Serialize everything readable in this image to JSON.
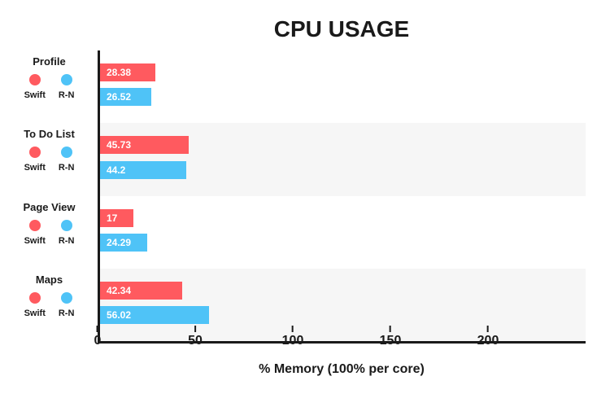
{
  "chart_data": {
    "type": "bar",
    "orientation": "horizontal",
    "title": "CPU USAGE",
    "xlabel": "% Memory (100% per core)",
    "ylabel": "",
    "xlim": [
      0,
      250
    ],
    "x_ticks": [
      0,
      50,
      100,
      150,
      200
    ],
    "categories": [
      "Profile",
      "To Do List",
      "Page View",
      "Maps"
    ],
    "series": [
      {
        "name": "Swift",
        "color": "#ff5a5f",
        "values": [
          28.38,
          45.73,
          17,
          42.34
        ]
      },
      {
        "name": "R-N",
        "color": "#4fc3f7",
        "values": [
          26.52,
          44.2,
          24.29,
          56.02
        ]
      }
    ],
    "legend": {
      "items": [
        {
          "name": "Swift",
          "color": "#ff5a5f"
        },
        {
          "name": "R-N",
          "color": "#4fc3f7"
        }
      ]
    }
  }
}
